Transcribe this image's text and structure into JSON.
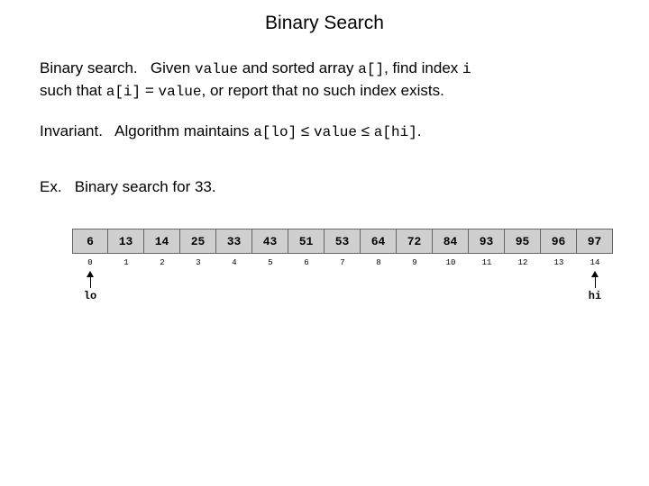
{
  "title": "Binary Search",
  "p1": {
    "lead": "Binary search.",
    "t1": "Given ",
    "code1": "value",
    "t2": " and sorted array ",
    "code2": "a[]",
    "t3": ", find index ",
    "code3": "i",
    "t4": "such that ",
    "code4": "a[i]",
    "t5": " = ",
    "code5": "value",
    "t6": ", or report that no such index exists."
  },
  "p2": {
    "lead": "Invariant.",
    "t1": "Algorithm maintains ",
    "code1": "a[lo]",
    "le1": " ≤ ",
    "code2": "value",
    "le2": " ≤ ",
    "code3": "a[hi]",
    "dot": "."
  },
  "p3": {
    "lead": "Ex.",
    "t1": "Binary search for 33."
  },
  "array": {
    "values": [
      "6",
      "13",
      "14",
      "25",
      "33",
      "43",
      "51",
      "53",
      "64",
      "72",
      "84",
      "93",
      "95",
      "96",
      "97"
    ],
    "indices": [
      "0",
      "1",
      "2",
      "3",
      "4",
      "5",
      "6",
      "7",
      "8",
      "9",
      "10",
      "11",
      "12",
      "13",
      "14"
    ],
    "lo_index": 0,
    "hi_index": 14,
    "lo_label": "lo",
    "hi_label": "hi"
  }
}
